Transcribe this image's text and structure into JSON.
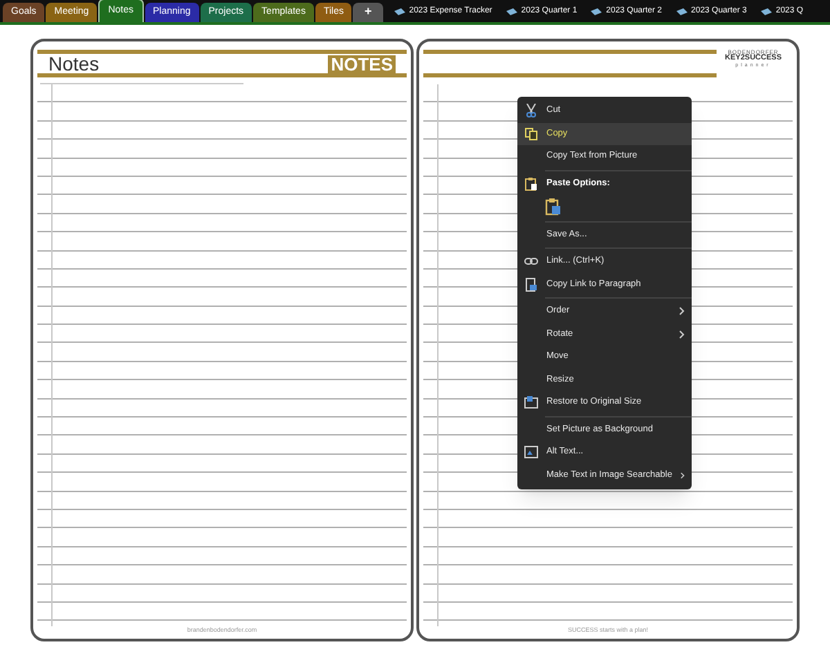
{
  "section_tabs": [
    {
      "label": "Goals",
      "color": "#6b4226",
      "selected": false
    },
    {
      "label": "Meeting",
      "color": "#8a6414",
      "selected": false
    },
    {
      "label": "Notes",
      "color": "#1f6e1f",
      "selected": true
    },
    {
      "label": "Planning",
      "color": "#2b2ba6",
      "selected": false
    },
    {
      "label": "Projects",
      "color": "#1d6e4a",
      "selected": false
    },
    {
      "label": "Templates",
      "color": "#4d6b1c",
      "selected": false
    },
    {
      "label": "Tiles",
      "color": "#8f5c12",
      "selected": false
    }
  ],
  "add_tab": {
    "label": "+"
  },
  "notebooks": [
    {
      "label": "2023 Expense Tracker"
    },
    {
      "label": "2023 Quarter 1"
    },
    {
      "label": "2023 Quarter 2"
    },
    {
      "label": "2023 Quarter 3"
    },
    {
      "label": "2023 Q"
    }
  ],
  "left_page": {
    "title": "Notes",
    "badge": "NOTES",
    "footer": "brandenbodendorfer.com"
  },
  "right_page": {
    "logo": {
      "line_1": "BODENDORFER",
      "line_2": "KEY2SUCCESS",
      "line_3": "planner"
    },
    "footer": "SUCCESS starts with a plan!"
  },
  "context_menu": [
    {
      "kind": "item",
      "label": "Cut",
      "selected": false
    },
    {
      "kind": "item",
      "label": "Copy",
      "selected": true
    },
    {
      "kind": "item",
      "label": "Copy Text from Picture",
      "selected": false
    },
    {
      "kind": "separator"
    },
    {
      "kind": "header",
      "label": "Paste Options:"
    },
    {
      "kind": "paste"
    },
    {
      "kind": "separator"
    },
    {
      "kind": "item",
      "label": "Save As...",
      "selected": false
    },
    {
      "kind": "separator"
    },
    {
      "kind": "item",
      "label": "Link...  (Ctrl+K)",
      "selected": false
    },
    {
      "kind": "item",
      "label": "Copy Link to Paragraph",
      "selected": false
    },
    {
      "kind": "separator"
    },
    {
      "kind": "item",
      "label": "Order",
      "submenu": true,
      "selected": false
    },
    {
      "kind": "item",
      "label": "Rotate",
      "submenu": true,
      "selected": false
    },
    {
      "kind": "item",
      "label": "Move",
      "selected": false
    },
    {
      "kind": "item",
      "label": "Resize",
      "selected": false
    },
    {
      "kind": "item",
      "label": "Restore to Original Size",
      "selected": false
    },
    {
      "kind": "separator"
    },
    {
      "kind": "item",
      "label": "Set Picture as Background",
      "selected": false
    },
    {
      "kind": "item",
      "label": "Alt Text...",
      "selected": false
    },
    {
      "kind": "item",
      "label": "Make Text in Image Searchable",
      "submenu": true,
      "selected": false
    }
  ]
}
